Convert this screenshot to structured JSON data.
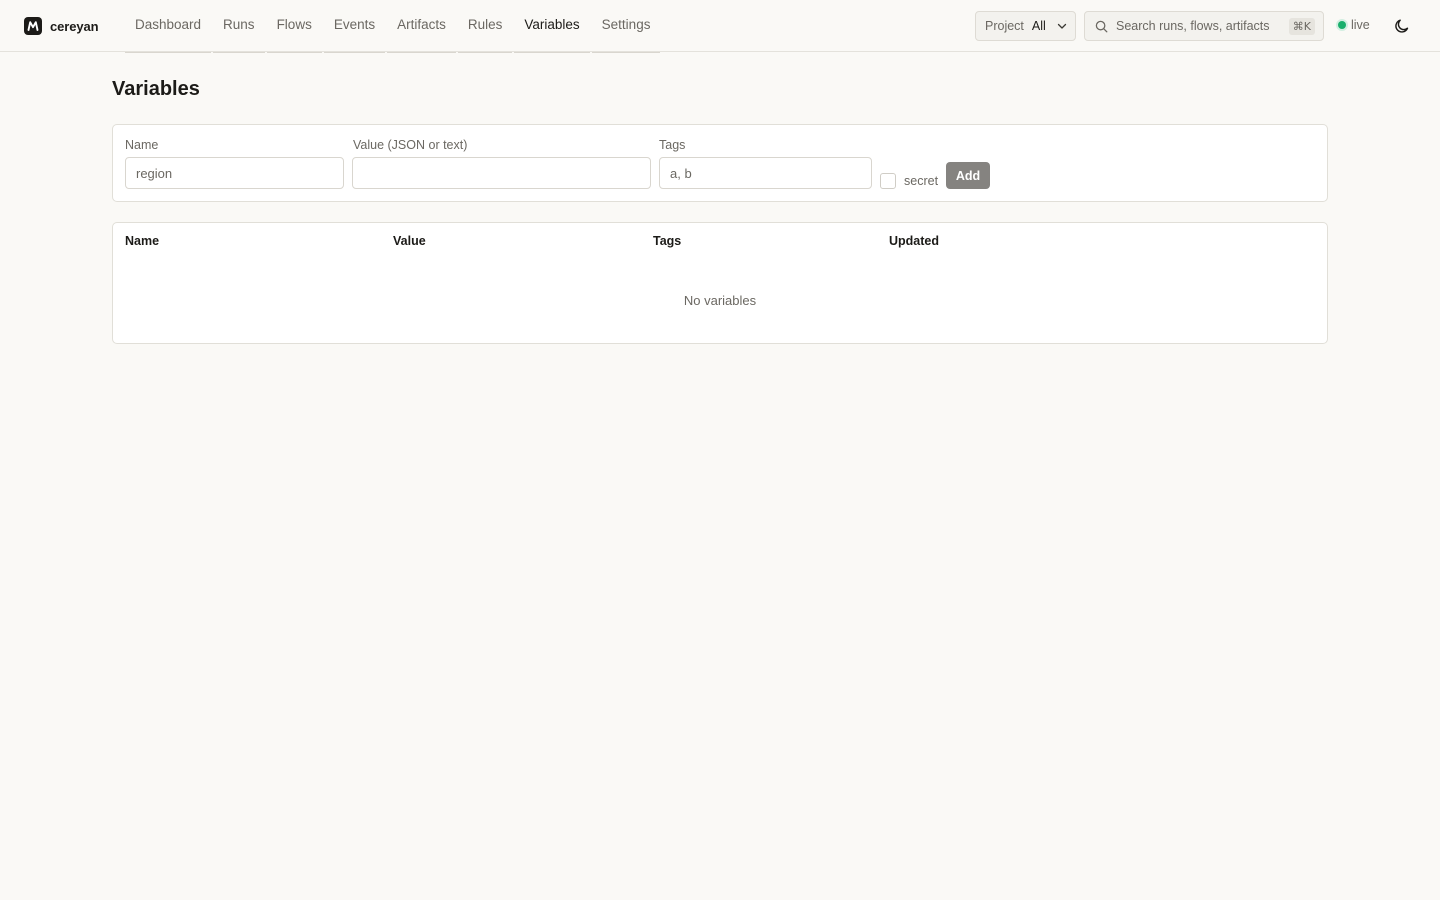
{
  "app": {
    "brand_name": "cereyan",
    "logo_icon": "brand-logo-icon"
  },
  "nav": {
    "items": [
      {
        "label": "Dashboard",
        "active": false
      },
      {
        "label": "Runs",
        "active": false
      },
      {
        "label": "Flows",
        "active": false
      },
      {
        "label": "Events",
        "active": false
      },
      {
        "label": "Artifacts",
        "active": false
      },
      {
        "label": "Rules",
        "active": false
      },
      {
        "label": "Variables",
        "active": true
      },
      {
        "label": "Settings",
        "active": false
      }
    ]
  },
  "header": {
    "project_label": "Project",
    "project_value": "All",
    "search_placeholder": "Search runs, flows, artifacts",
    "search_shortcut": "⌘K",
    "status_text": "live",
    "status_color": "#1aaf6c",
    "theme_icon": "moon-icon"
  },
  "page": {
    "title": "Variables"
  },
  "form": {
    "name_label": "Name",
    "name_placeholder": "region",
    "value_label": "Value (JSON or text)",
    "value_placeholder": "",
    "tags_label": "Tags",
    "tags_placeholder": "a, b",
    "secret_label": "secret",
    "secret_checked": false,
    "add_label": "Add"
  },
  "table": {
    "columns": [
      "Name",
      "Value",
      "Tags",
      "Updated"
    ],
    "rows": [],
    "empty_text": "No variables"
  },
  "colors": {
    "background": "#faf9f6",
    "accent": "#1c1b18",
    "add_button": "#858380"
  }
}
